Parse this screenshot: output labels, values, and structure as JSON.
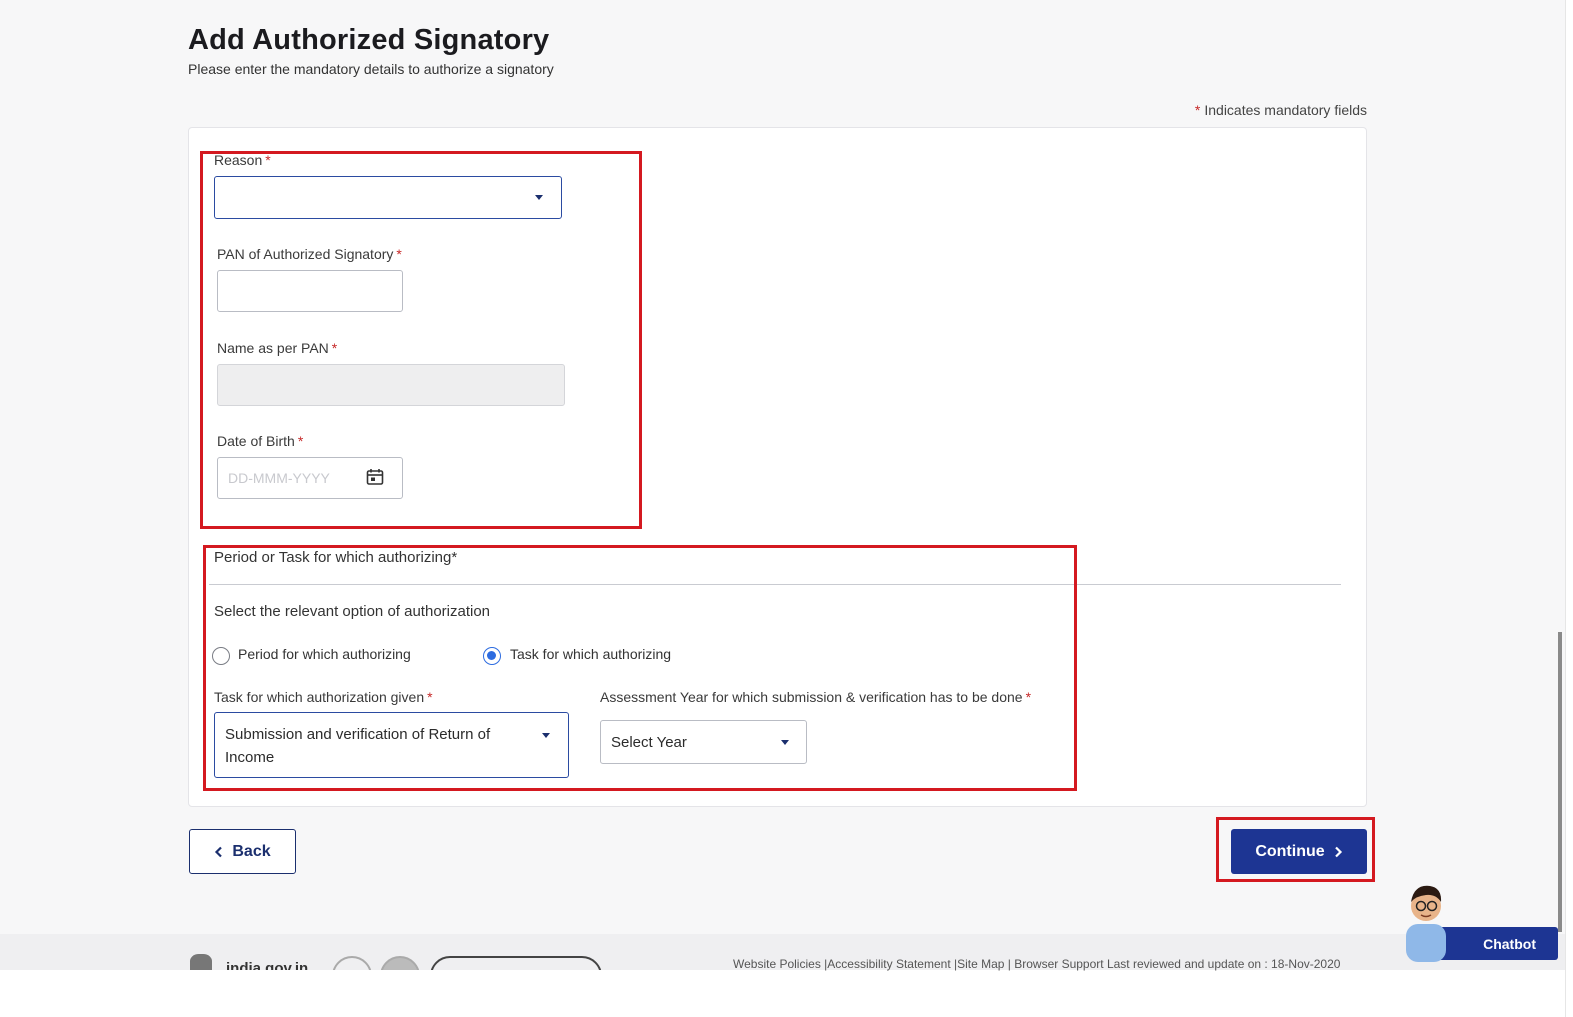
{
  "header": {
    "title": "Add Authorized Signatory",
    "subtitle": "Please enter the mandatory details to authorize a signatory",
    "mandatory_star": "*",
    "mandatory_note": "Indicates mandatory fields"
  },
  "form": {
    "reason": {
      "label": "Reason",
      "required": "*",
      "value": ""
    },
    "pan": {
      "label": "PAN of Authorized Signatory",
      "required": "*",
      "value": ""
    },
    "name": {
      "label": "Name as per PAN",
      "required": "*",
      "value": ""
    },
    "dob": {
      "label": "Date of Birth",
      "required": "*",
      "placeholder": "DD-MMM-YYYY"
    }
  },
  "authorization": {
    "section_title": "Period or Task for which authorizing*",
    "help_text": "Select the relevant option of authorization",
    "radio_period": {
      "label": "Period for which authorizing",
      "checked": false
    },
    "radio_task": {
      "label": "Task for which authorizing",
      "checked": true
    },
    "task": {
      "label": "Task for which authorization given",
      "required": "*",
      "value": "Submission and verification of Return of Income"
    },
    "year": {
      "label": "Assessment Year for which submission & verification has to be done",
      "required": "*",
      "value": "Select Year"
    }
  },
  "buttons": {
    "back": "Back",
    "continue": "Continue"
  },
  "footer": {
    "logo_text": "india.gov.in",
    "links": "Website Policies |Accessibility Statement |Site Map | Browser Support   Last reviewed and update on : 18-Nov-2020"
  },
  "chatbot": {
    "label": "Chatbot"
  },
  "colors": {
    "primary": "#1d3593",
    "highlight": "#d41920",
    "required": "#c62828",
    "radio_selected": "#2d6ce0"
  },
  "icons": [
    "calendar-icon",
    "chevron-left-icon",
    "chevron-right-icon",
    "chevron-down-icon",
    "national-emblem-icon",
    "chatbot-avatar-icon"
  ]
}
